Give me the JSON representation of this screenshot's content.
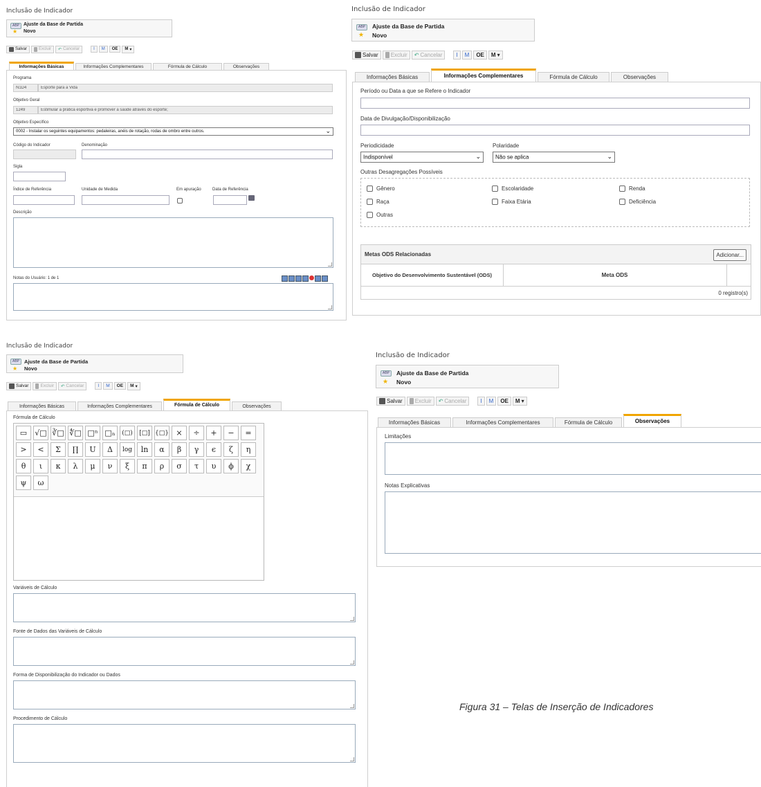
{
  "common": {
    "title": "Inclusão de Indicador",
    "record_badge": "ABP",
    "record_name": "Ajuste da Base de Partida",
    "record_status": "Novo",
    "toolbar": {
      "save": "Salvar",
      "delete": "Excluir",
      "cancel": "Cancelar",
      "i": "I",
      "m": "M",
      "oe": "OE",
      "m2": "M"
    },
    "tabs": [
      "Informações Básicas",
      "Informações Complementares",
      "Fórmula de Cálculo",
      "Observações"
    ]
  },
  "basic": {
    "programa_label": "Programa",
    "programa_code": "N1D4",
    "programa_name": "Esporte para a Vida",
    "objetivo_geral_label": "Objetivo Geral",
    "objetivo_geral_code": "1249",
    "objetivo_geral_text": "Estimular a prática esportiva e promover a saúde através do esporte;",
    "objetivo_especifico_label": "Objetivo Específico",
    "objetivo_especifico_value": "0002 - Instalar os seguintes equipamentos: pedaleiras, anéis de rotação, rodas de ombro entre outros.",
    "codigo_label": "Código do Indicador",
    "denominacao_label": "Denominação",
    "sigla_label": "Sigla",
    "indice_label": "Índice de Referência",
    "unidade_label": "Unidade de Medida",
    "em_apuracao_label": "Em apuração",
    "data_ref_label": "Data de Referência",
    "descricao_label": "Descrição",
    "notas_label": "Notas do Usuário: 1 de 1"
  },
  "complementary": {
    "periodo_label": "Período ou Data a que se Refere o Indicador",
    "divulgacao_label": "Data de Divulgação/Disponibilização",
    "periodicidade_label": "Periodicidade",
    "periodicidade_value": "Indisponível",
    "polaridade_label": "Polaridade",
    "polaridade_value": "Não se aplica",
    "desagregacoes_label": "Outras Desagregações Possíveis",
    "checkboxes": [
      "Gênero",
      "Escolaridade",
      "Renda",
      "Raça",
      "Faixa Etária",
      "Deficiência",
      "Outras"
    ],
    "metas_title": "Metas ODS Relacionadas",
    "add_button": "Adicionar...",
    "col_ods": "Objetivo do Desenvolvimento Sustentável (ODS)",
    "col_meta": "Meta ODS",
    "records": "0 registro(s)"
  },
  "formula": {
    "formula_label": "Fórmula de Cálculo",
    "symbols": [
      [
        "▭",
        "√□",
        "∛□",
        "∜□",
        "□ⁿ",
        "□ₙ",
        "(□)",
        "[□]",
        "{□}",
        "×",
        "÷",
        "+",
        "−",
        "="
      ],
      [
        ">",
        "<",
        "Σ",
        "∏",
        "U",
        "Δ",
        "log",
        "ln",
        "α",
        "β",
        "γ",
        "ϵ",
        "ζ",
        "η"
      ],
      [
        "θ",
        "ι",
        "κ",
        "λ",
        "μ",
        "ν",
        "ξ",
        "π",
        "ρ",
        "σ",
        "τ",
        "υ",
        "ϕ",
        "χ"
      ],
      [
        "ψ",
        "ω"
      ]
    ],
    "variaveis_label": "Variáveis de Cálculo",
    "fonte_label": "Fonte de Dados das Variáveis de Cálculo",
    "forma_label": "Forma de Disponibilização do Indicador ou Dados",
    "procedimento_label": "Procedimento de Cálculo"
  },
  "observations": {
    "limitacoes_label": "Limitações",
    "notas_label": "Notas Explicativas"
  },
  "caption": "Figura 31 – Telas de Inserção de Indicadores"
}
